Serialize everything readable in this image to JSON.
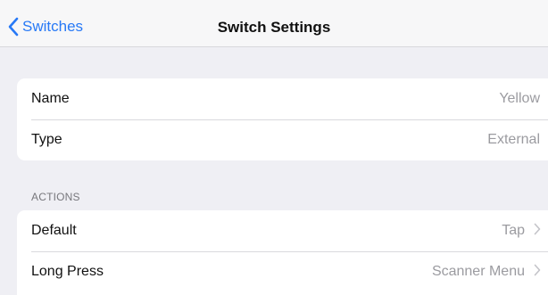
{
  "navbar": {
    "back_label": "Switches",
    "title": "Switch Settings"
  },
  "general": {
    "rows": [
      {
        "label": "Name",
        "value": "Yellow"
      },
      {
        "label": "Type",
        "value": "External"
      }
    ]
  },
  "actions": {
    "header": "ACTIONS",
    "rows": [
      {
        "label": "Default",
        "value": "Tap"
      },
      {
        "label": "Long Press",
        "value": "Scanner Menu"
      }
    ]
  },
  "colors": {
    "accent": "#2779f6",
    "background": "#efeff4",
    "secondary_text": "#9b9ba0"
  },
  "icons": {
    "back": "chevron-left-icon",
    "disclosure": "chevron-right-icon"
  }
}
